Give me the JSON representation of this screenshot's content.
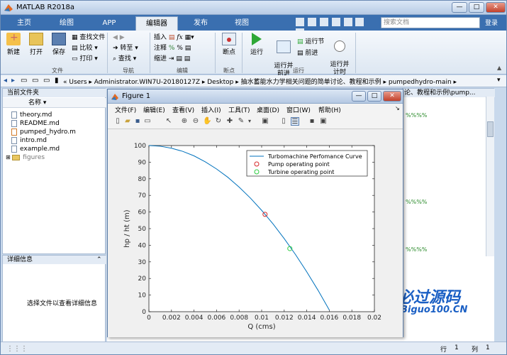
{
  "app": {
    "title": "MATLAB R2018a"
  },
  "window_controls": {
    "minimize": "—",
    "maximize": "□",
    "close": "✕"
  },
  "tabs": [
    {
      "label": "主页"
    },
    {
      "label": "绘图"
    },
    {
      "label": "APP"
    },
    {
      "label": "编辑器"
    },
    {
      "label": "发布"
    },
    {
      "label": "视图"
    }
  ],
  "search": {
    "placeholder": "搜索文档"
  },
  "login": "登录",
  "ribbon": {
    "new": "新建",
    "open": "打开",
    "save": "保存",
    "find_files": "查找文件",
    "compare": "比较",
    "print": "打印",
    "group_file": "文件",
    "goto": "转至",
    "find": "查找",
    "group_nav": "导航",
    "insert": "插入",
    "comment": "注释",
    "indent": "缩进",
    "fx": "fx",
    "group_edit": "编辑",
    "breakpoints": "断点",
    "group_breakpoints": "断点",
    "run": "运行",
    "run_advance": "运行并\n前进",
    "run_section": "运行节",
    "advance": "前进",
    "run_time": "运行并\n计时",
    "group_run": "运行"
  },
  "address": {
    "path": "«  Users  ▸  Administrator.WIN7U-20180127Z  ▸  Desktop  ▸  抽水蓄能水力学相关问题的简单讨论、教程和示例  ▸  pumpedhydro-main  ▸"
  },
  "file_panel": {
    "title": "当前文件夹",
    "column": "名称 ▾",
    "files": [
      {
        "name": "theory.md"
      },
      {
        "name": "README.md"
      },
      {
        "name": "pumped_hydro.m"
      },
      {
        "name": "intro.md"
      },
      {
        "name": "example.md"
      }
    ],
    "folder": "figures"
  },
  "detail_panel": {
    "title": "详细信息",
    "message": "选择文件以查看详细信息"
  },
  "right_panel": {
    "header": "论、教程和示例\\pump..."
  },
  "status": {
    "row_label": "行",
    "row_value": "1",
    "col_label": "列",
    "col_value": "1"
  },
  "figure": {
    "title": "Figure 1",
    "menu": [
      "文件(F)",
      "编辑(E)",
      "查看(V)",
      "插入(I)",
      "工具(T)",
      "桌面(D)",
      "窗口(W)",
      "帮助(H)"
    ]
  },
  "watermark": {
    "text": "必过源码",
    "sub": "Biguo100.CN"
  },
  "chart_data": {
    "type": "line",
    "xlabel": "Q (cms)",
    "ylabel": "hp / ht (m)",
    "xlim": [
      0,
      0.02
    ],
    "ylim": [
      0,
      100
    ],
    "xticks": [
      0,
      0.002,
      0.004,
      0.006,
      0.008,
      0.01,
      0.012,
      0.014,
      0.016,
      0.018,
      0.02
    ],
    "yticks": [
      0,
      10,
      20,
      30,
      40,
      50,
      60,
      70,
      80,
      90,
      100
    ],
    "grid": false,
    "legend_position": "top-right",
    "series": [
      {
        "name": "Turbomachine Perfomance Curve",
        "style": "line",
        "color": "#0072bd",
        "x": [
          0,
          0.001,
          0.002,
          0.003,
          0.004,
          0.005,
          0.006,
          0.007,
          0.008,
          0.009,
          0.01,
          0.011,
          0.012,
          0.013,
          0.014,
          0.015,
          0.016
        ],
        "y": [
          100,
          99.6,
          98.4,
          96.5,
          93.8,
          90.2,
          85.9,
          80.9,
          75.0,
          68.4,
          61.0,
          52.9,
          44.0,
          34.4,
          24.0,
          12.9,
          1.0
        ]
      },
      {
        "name": "Pump operating point",
        "style": "marker",
        "color": "#d62728",
        "x": [
          0.0103
        ],
        "y": [
          58.6
        ]
      },
      {
        "name": "Turbine operating point",
        "style": "marker",
        "color": "#2ecc40",
        "x": [
          0.0125
        ],
        "y": [
          38.0
        ]
      }
    ]
  }
}
